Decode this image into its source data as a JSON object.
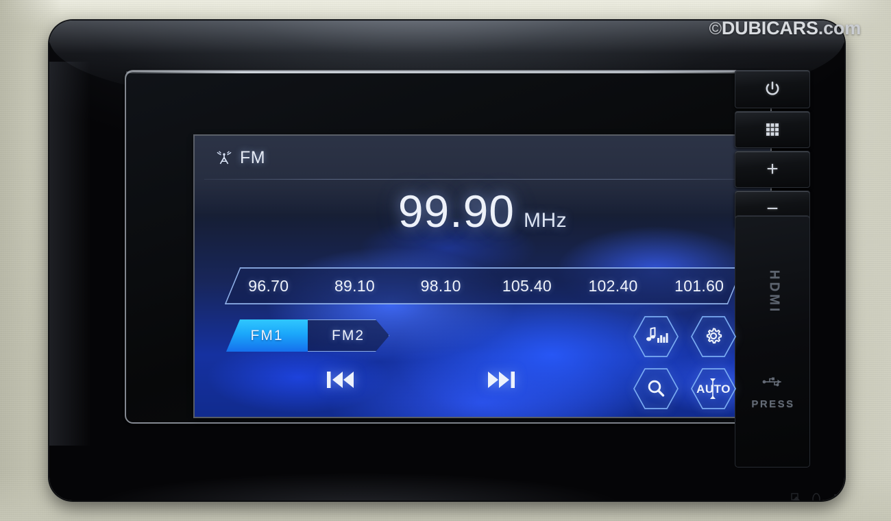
{
  "watermark": {
    "copyright": "©",
    "brand": "DUBICARS",
    "tld": ".com"
  },
  "screen": {
    "header": {
      "band_label": "FM",
      "antenna_icon": "radio-antenna-icon"
    },
    "now_playing": {
      "frequency": "99.90",
      "unit": "MHz"
    },
    "presets": [
      {
        "value": "96.70"
      },
      {
        "value": "89.10"
      },
      {
        "value": "98.10"
      },
      {
        "value": "105.40"
      },
      {
        "value": "102.40"
      },
      {
        "value": "101.60"
      }
    ],
    "band_switch": {
      "options": [
        {
          "label": "FM1",
          "selected": true
        },
        {
          "label": "FM2",
          "selected": false
        }
      ]
    },
    "transport": [
      {
        "name": "previous-track-button",
        "icon": "skip-previous-icon"
      },
      {
        "name": "next-track-button",
        "icon": "skip-next-icon"
      }
    ],
    "function_buttons": [
      {
        "name": "equalizer-button",
        "icon": "music-equalizer-icon"
      },
      {
        "name": "settings-button",
        "icon": "gear-icon"
      },
      {
        "name": "scan-search-button",
        "icon": "magnifier-icon"
      },
      {
        "name": "auto-store-button",
        "icon": "auto-updown-icon",
        "label": "AUTO"
      }
    ],
    "colors": {
      "accent_active": "#1aa7fb",
      "outline": "#a0c3fa",
      "text": "#eef2fa",
      "background_top": "#2b3245",
      "background_bottom": "#1430a0"
    }
  },
  "hardware": {
    "buttons": [
      {
        "name": "power-button",
        "icon": "power-icon"
      },
      {
        "name": "apps-grid-button",
        "icon": "grid-3x3-icon"
      },
      {
        "name": "volume-up-button",
        "icon": "plus-icon",
        "glyph": "+"
      },
      {
        "name": "volume-down-button",
        "icon": "minus-icon",
        "glyph": "−"
      }
    ],
    "port_panel": {
      "hdmi_label": "HDMI",
      "usb_icon": "usb-icon",
      "press_label": "PRESS"
    }
  }
}
